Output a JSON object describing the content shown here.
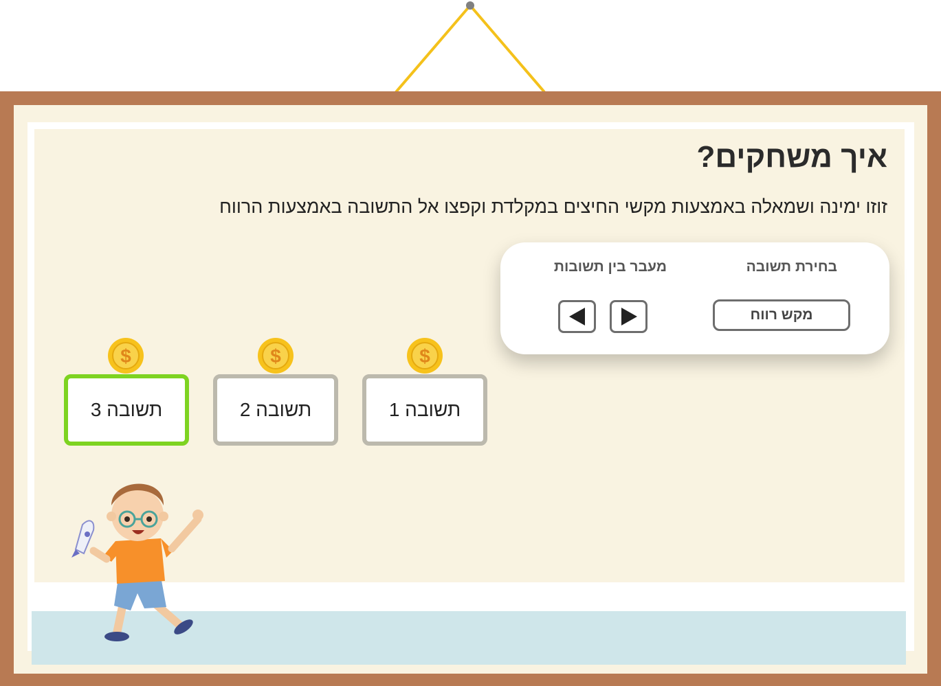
{
  "title": "איך משחקים?",
  "instructions": "זוזו ימינה ושמאלה באמצעות מקשי החיצים במקלדת וקפצו אל התשובה באמצעות הרווח",
  "controls": {
    "select_heading": "בחירת תשובה",
    "navigate_heading": "מעבר בין תשובות",
    "space_key_label": "מקש רווח"
  },
  "answers": [
    {
      "label": "תשובה 1",
      "selected": false
    },
    {
      "label": "תשובה 2",
      "selected": false
    },
    {
      "label": "תשובה 3",
      "selected": true
    }
  ],
  "coin_symbol": "$",
  "colors": {
    "frame": "#b87a53",
    "board": "#f9f3e1",
    "selected_border": "#7ed321",
    "default_border": "#bcb9ad",
    "floor": "#cfe6ea",
    "coin": "#f7c21c",
    "string": "#f4c11b"
  },
  "icons": [
    "arrow-left-icon",
    "arrow-right-icon",
    "coin-icon",
    "boy-character-icon",
    "rocket-toy-icon"
  ]
}
